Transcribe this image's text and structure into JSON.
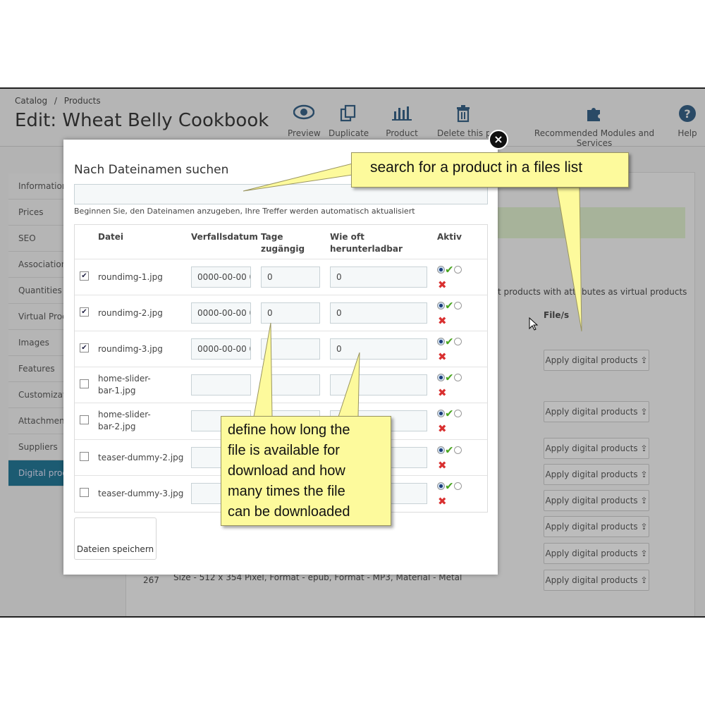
{
  "header": {
    "breadcrumb": [
      "Catalog",
      "/",
      "Products"
    ],
    "title": "Edit: Wheat Belly Cookbook",
    "toolbar": [
      {
        "label": "Preview",
        "icon": "eye-icon"
      },
      {
        "label": "Duplicate",
        "icon": "copy-icon"
      },
      {
        "label": "Product sales",
        "icon": "bar-chart-icon"
      },
      {
        "label": "Delete this p",
        "icon": "trash-icon"
      },
      {
        "label": "Recommended Modules and Services",
        "icon": "puzzle-icon"
      },
      {
        "label": "Help",
        "icon": "help-icon"
      }
    ]
  },
  "sidebar": {
    "items": [
      "Information",
      "Prices",
      "SEO",
      "Associations",
      "Quantities",
      "Virtual Prod",
      "Images",
      "Features",
      "Customizati",
      "Attachments",
      "Suppliers",
      "Digital prod"
    ],
    "active": "Digital prod"
  },
  "background": {
    "virtual_text": "t products with attributes as virtual products",
    "files_header": "File/s",
    "apply_label": "Apply digital products",
    "row_number": "267",
    "row_desc": "Size - 512 x 354 Pixel, Format - epub, Format - MP3, Material - Metal"
  },
  "modal": {
    "title": "Nach Dateinamen suchen",
    "search_value": "",
    "help_text": "Beginnen Sie, den Dateinamen anzugeben, Ihre Treffer werden automatisch aktualisiert",
    "columns": {
      "file": "Datei",
      "expiry": "Verfallsdatum",
      "days": "Tage zugängig",
      "downloads": "Wie oft herunterladbar",
      "active": "Aktiv"
    },
    "rows": [
      {
        "checked": true,
        "file": "roundimg-1.jpg",
        "expiry": "0000-00-00 0",
        "days": "0",
        "downloads": "0"
      },
      {
        "checked": true,
        "file": "roundimg-2.jpg",
        "expiry": "0000-00-00 0",
        "days": "0",
        "downloads": "0"
      },
      {
        "checked": true,
        "file": "roundimg-3.jpg",
        "expiry": "0000-00-00 0",
        "days": "",
        "downloads": "0"
      },
      {
        "checked": false,
        "file": "home-slider-bar-1.jpg",
        "expiry": "",
        "days": "",
        "downloads": ""
      },
      {
        "checked": false,
        "file": "home-slider-bar-2.jpg",
        "expiry": "",
        "days": "",
        "downloads": ""
      },
      {
        "checked": false,
        "file": "teaser-dummy-2.jpg",
        "expiry": "",
        "days": "",
        "downloads": ""
      },
      {
        "checked": false,
        "file": "teaser-dummy-3.jpg",
        "expiry": "",
        "days": "",
        "downloads": ""
      }
    ],
    "save_label": "Dateien speichern",
    "close_symbol": "×"
  },
  "callouts": {
    "search": "search for a product in a files list",
    "define": [
      "define how long the",
      "file is available for",
      "download and how",
      "many times the file",
      "can be downloaded"
    ]
  },
  "colors": {
    "callout_fill": "#fdfa9c",
    "active_sidebar": "#1c5b72",
    "check_green": "#4aa520",
    "cross_red": "#d93030"
  }
}
